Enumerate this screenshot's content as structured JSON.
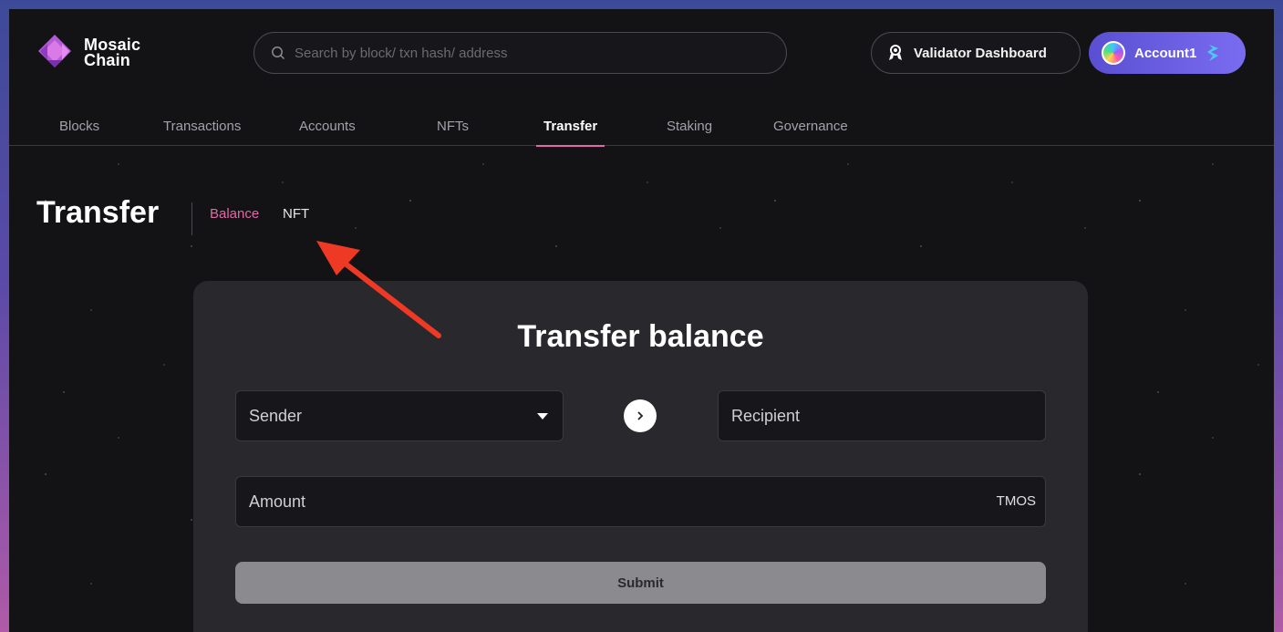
{
  "brand": {
    "line1": "Mosaic",
    "line2": "Chain"
  },
  "search": {
    "placeholder": "Search by block/ txn hash/ address"
  },
  "header": {
    "validator_label": "Validator Dashboard",
    "account_label": "Account1"
  },
  "nav": {
    "items": [
      {
        "label": "Blocks"
      },
      {
        "label": "Transactions"
      },
      {
        "label": "Accounts"
      },
      {
        "label": "NFTs"
      },
      {
        "label": "Transfer",
        "active": true
      },
      {
        "label": "Staking"
      },
      {
        "label": "Governance"
      }
    ]
  },
  "page": {
    "title": "Transfer",
    "sub_tabs": [
      {
        "label": "Balance",
        "active": true
      },
      {
        "label": "NFT"
      }
    ]
  },
  "form": {
    "title": "Transfer balance",
    "sender_placeholder": "Sender",
    "recipient_placeholder": "Recipient",
    "amount_placeholder": "Amount",
    "amount_unit": "TMOS",
    "submit_label": "Submit"
  },
  "colors": {
    "accent_pink": "#e06aa8",
    "account_purple": "#6b5ee3",
    "annotation_arrow": "#ee3a24"
  }
}
